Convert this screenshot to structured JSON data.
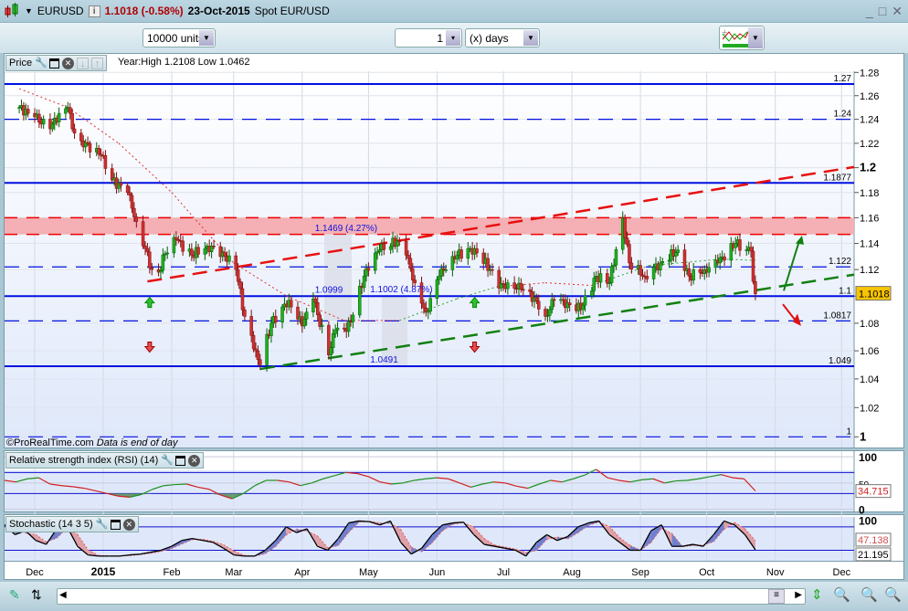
{
  "header": {
    "symbol": "EURUSD",
    "price": "1.1018 (-0.58%)",
    "date": "23-Oct-2015",
    "description": "Spot EUR/USD",
    "min": "_",
    "max": "□",
    "close": "✕"
  },
  "toolbar": {
    "units": "10000 units",
    "period_value": "1",
    "period_unit": "(x) days"
  },
  "price_panel": {
    "title": "Price",
    "info": "Year:High 1.2108 Low 1.0462",
    "credit": "©ProRealTime.com",
    "credit_note": "Data is end of day",
    "current_price": "1.1018"
  },
  "rsi_panel": {
    "title": "Relative strength index (RSI) (14)",
    "current": "34.715",
    "ticks": [
      "100",
      "50",
      "0"
    ]
  },
  "stoch_panel": {
    "title": "Stochastic (14 3 5)",
    "current_d": "47.138",
    "current_k": "21.195",
    "ticks": [
      "100"
    ]
  },
  "time_axis": [
    "Dec",
    "2015",
    "Feb",
    "Mar",
    "Apr",
    "May",
    "Jun",
    "Jul",
    "Aug",
    "Sep",
    "Oct",
    "Nov",
    "Dec"
  ],
  "chart_data": {
    "type": "candlestick",
    "scale": "log",
    "ylim": [
      1.0,
      1.28
    ],
    "y_ticks": [
      "1.28",
      "1.26",
      "1.24",
      "1.22",
      "1.2",
      "1.18",
      "1.16",
      "1.14",
      "1.12",
      "1.1",
      "1.08",
      "1.06",
      "1.04",
      "1.02",
      "1"
    ],
    "close_anchors": [
      [
        "2014-11-24",
        1.25
      ],
      [
        "2014-11-28",
        1.245
      ],
      [
        "2014-12-01",
        1.242
      ],
      [
        "2014-12-08",
        1.232
      ],
      [
        "2014-12-12",
        1.245
      ],
      [
        "2014-12-16",
        1.25
      ],
      [
        "2014-12-18",
        1.232
      ],
      [
        "2014-12-22",
        1.222
      ],
      [
        "2014-12-31",
        1.21
      ],
      [
        "2015-01-05",
        1.19
      ],
      [
        "2015-01-12",
        1.18
      ],
      [
        "2015-01-16",
        1.157
      ],
      [
        "2015-01-23",
        1.12
      ],
      [
        "2015-01-26",
        1.118
      ],
      [
        "2015-01-29",
        1.132
      ],
      [
        "2015-02-03",
        1.143
      ],
      [
        "2015-02-10",
        1.131
      ],
      [
        "2015-02-17",
        1.138
      ],
      [
        "2015-02-24",
        1.133
      ],
      [
        "2015-03-02",
        1.12
      ],
      [
        "2015-03-06",
        1.085
      ],
      [
        "2015-03-11",
        1.06
      ],
      [
        "2015-03-13",
        1.05
      ],
      [
        "2015-03-18",
        1.08
      ],
      [
        "2015-03-23",
        1.092
      ],
      [
        "2015-03-26",
        1.097
      ],
      [
        "2015-04-01",
        1.078
      ],
      [
        "2015-04-06",
        1.098
      ],
      [
        "2015-04-13",
        1.057
      ],
      [
        "2015-04-16",
        1.075
      ],
      [
        "2015-04-21",
        1.074
      ],
      [
        "2015-04-24",
        1.086
      ],
      [
        "2015-04-30",
        1.121
      ],
      [
        "2015-05-06",
        1.135
      ],
      [
        "2015-05-14",
        1.142
      ],
      [
        "2015-05-18",
        1.131
      ],
      [
        "2015-05-22",
        1.11
      ],
      [
        "2015-05-27",
        1.088
      ],
      [
        "2015-06-02",
        1.115
      ],
      [
        "2015-06-08",
        1.13
      ],
      [
        "2015-06-18",
        1.136
      ],
      [
        "2015-06-25",
        1.12
      ],
      [
        "2015-06-29",
        1.106
      ],
      [
        "2015-07-03",
        1.11
      ],
      [
        "2015-07-09",
        1.105
      ],
      [
        "2015-07-15",
        1.099
      ],
      [
        "2015-07-20",
        1.085
      ],
      [
        "2015-07-24",
        1.097
      ],
      [
        "2015-07-30",
        1.095
      ],
      [
        "2015-08-05",
        1.09
      ],
      [
        "2015-08-12",
        1.115
      ],
      [
        "2015-08-18",
        1.11
      ],
      [
        "2015-08-24",
        1.16
      ],
      [
        "2015-08-27",
        1.125
      ],
      [
        "2015-09-03",
        1.115
      ],
      [
        "2015-09-10",
        1.125
      ],
      [
        "2015-09-18",
        1.135
      ],
      [
        "2015-09-23",
        1.115
      ],
      [
        "2015-09-30",
        1.12
      ],
      [
        "2015-10-06",
        1.125
      ],
      [
        "2015-10-14",
        1.14
      ],
      [
        "2015-10-19",
        1.135
      ],
      [
        "2015-10-21",
        1.134
      ],
      [
        "2015-10-22",
        1.111
      ],
      [
        "2015-10-23",
        1.1018
      ]
    ],
    "moving_average": [
      [
        "2014-11-24",
        1.266,
        "red"
      ],
      [
        "2014-12-16",
        1.25,
        "red"
      ],
      [
        "2015-01-08",
        1.22,
        "red"
      ],
      [
        "2015-02-01",
        1.18,
        "red"
      ],
      [
        "2015-03-01",
        1.125,
        "red"
      ],
      [
        "2015-03-25",
        1.1,
        "red"
      ],
      [
        "2015-04-20",
        1.082,
        "red"
      ],
      [
        "2015-05-15",
        1.082,
        "green"
      ],
      [
        "2015-06-10",
        1.098,
        "green"
      ],
      [
        "2015-06-28",
        1.107,
        "red"
      ],
      [
        "2015-07-20",
        1.11,
        "red"
      ],
      [
        "2015-08-10",
        1.108,
        "green"
      ],
      [
        "2015-09-05",
        1.123,
        "green"
      ],
      [
        "2015-10-08",
        1.128,
        "green"
      ],
      [
        "2015-10-23",
        1.127,
        "green"
      ]
    ],
    "horizontal_levels": [
      {
        "value": 1.27,
        "label": "1.27",
        "style": "solid"
      },
      {
        "value": 1.24,
        "label": "1.24",
        "style": "dashed"
      },
      {
        "value": 1.1877,
        "label": "1.1877",
        "style": "solid"
      },
      {
        "value": 1.122,
        "label": "1.122",
        "style": "dashed"
      },
      {
        "value": 1.1,
        "label": "1.1",
        "style": "solid"
      },
      {
        "value": 1.0817,
        "label": "1.0817",
        "style": "dashed"
      },
      {
        "value": 1.049,
        "label": "1.049",
        "style": "solid"
      },
      {
        "value": 1.0,
        "label": "1",
        "style": "dashed"
      }
    ],
    "resistance_zone": [
      1.147,
      1.16
    ],
    "trendlines": [
      {
        "color": "red",
        "from": [
          "2015-01-21",
          1.111
        ],
        "to": [
          "2015-12-10",
          1.2015
        ]
      },
      {
        "color": "green",
        "from": [
          "2015-03-13",
          1.047
        ],
        "to": [
          "2015-12-10",
          1.117
        ]
      }
    ],
    "annotations": [
      {
        "text": "1.1469 (4.27%)",
        "date": "2015-04-15",
        "price": 1.1469
      },
      {
        "text": "1.0999",
        "date": "2015-04-15",
        "price": 1.0999
      },
      {
        "text": "1.1002 (4.87%)",
        "date": "2015-05-10",
        "price": 1.1002
      },
      {
        "text": "1.0491",
        "date": "2015-05-10",
        "price": 1.0491
      }
    ],
    "signals": [
      {
        "type": "up",
        "color": "green",
        "date": "2015-01-22",
        "price": 1.095
      },
      {
        "type": "down",
        "color": "red",
        "date": "2015-01-22",
        "price": 1.063
      },
      {
        "type": "up",
        "color": "green",
        "date": "2015-06-18",
        "price": 1.095
      },
      {
        "type": "down",
        "color": "red",
        "date": "2015-06-18",
        "price": 1.063
      }
    ],
    "rsi": {
      "levels": [
        70,
        30
      ],
      "values": [
        55,
        52,
        58,
        60,
        48,
        45,
        43,
        40,
        35,
        30,
        25,
        23,
        28,
        38,
        45,
        47,
        48,
        42,
        38,
        27,
        20,
        30,
        45,
        55,
        55,
        52,
        45,
        50,
        58,
        64,
        70,
        68,
        62,
        52,
        48,
        50,
        55,
        58,
        60,
        58,
        50,
        42,
        48,
        52,
        50,
        44,
        40,
        48,
        55,
        52,
        58,
        65,
        76,
        60,
        55,
        52,
        56,
        58,
        50,
        54,
        55,
        58,
        62,
        66,
        60,
        58,
        35
      ]
    },
    "stochastic": {
      "levels": [
        80,
        20
      ],
      "k": [
        85,
        60,
        70,
        45,
        35,
        75,
        80,
        30,
        8,
        5,
        5,
        5,
        8,
        10,
        15,
        20,
        30,
        45,
        50,
        45,
        40,
        25,
        8,
        5,
        5,
        20,
        45,
        80,
        65,
        75,
        30,
        20,
        50,
        90,
        95,
        93,
        85,
        95,
        40,
        10,
        25,
        60,
        85,
        90,
        92,
        60,
        35,
        30,
        25,
        20,
        5,
        40,
        60,
        45,
        55,
        80,
        90,
        95,
        60,
        40,
        20,
        20,
        70,
        85,
        30,
        30,
        35,
        30,
        60,
        95,
        85,
        60,
        21
      ]
    }
  }
}
